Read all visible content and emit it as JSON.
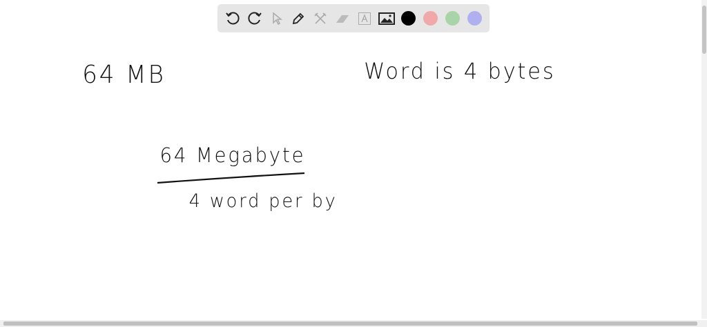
{
  "toolbar": {
    "tools": [
      "undo-icon",
      "redo-icon",
      "select-icon",
      "pen-icon",
      "tools-icon",
      "eraser-icon",
      "text-icon",
      "image-icon"
    ],
    "colors": [
      "#000000",
      "#f0a8a8",
      "#a8d4a8",
      "#b0b0f0"
    ]
  },
  "canvas": {
    "note1": "64 MB",
    "note2": "Word is 4 bytes",
    "numerator": "64 Megabyte",
    "denominator": "4 word per by"
  }
}
